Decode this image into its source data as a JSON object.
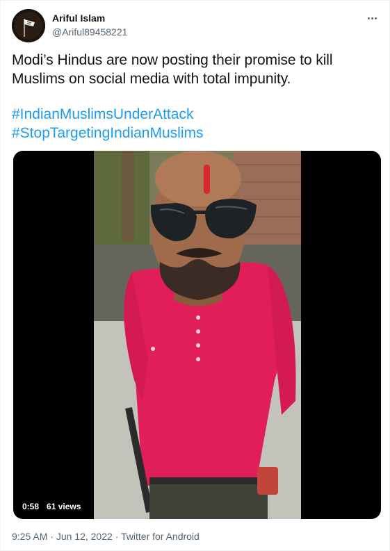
{
  "user": {
    "display_name": "Ariful Islam",
    "handle": "@Ariful89458221"
  },
  "tweet": {
    "text": "Modi’s Hindus are now posting their promise to kill Muslims on social media with total impunity.",
    "hashtags": [
      "#IndianMuslimsUnderAttack",
      "#StopTargetingIndianMuslims"
    ]
  },
  "media": {
    "duration": "0:58",
    "views": "61 views"
  },
  "footer": {
    "time": "9:25 AM",
    "separator": "·",
    "date": "Jun 12, 2022",
    "source": "Twitter for Android"
  },
  "colors": {
    "link": "#1d9bf0",
    "secondary_text": "#536471",
    "primary_text": "#0f1419",
    "shirt": "#e21e5a"
  },
  "icons": {
    "more": "more-horizontal-icon"
  }
}
